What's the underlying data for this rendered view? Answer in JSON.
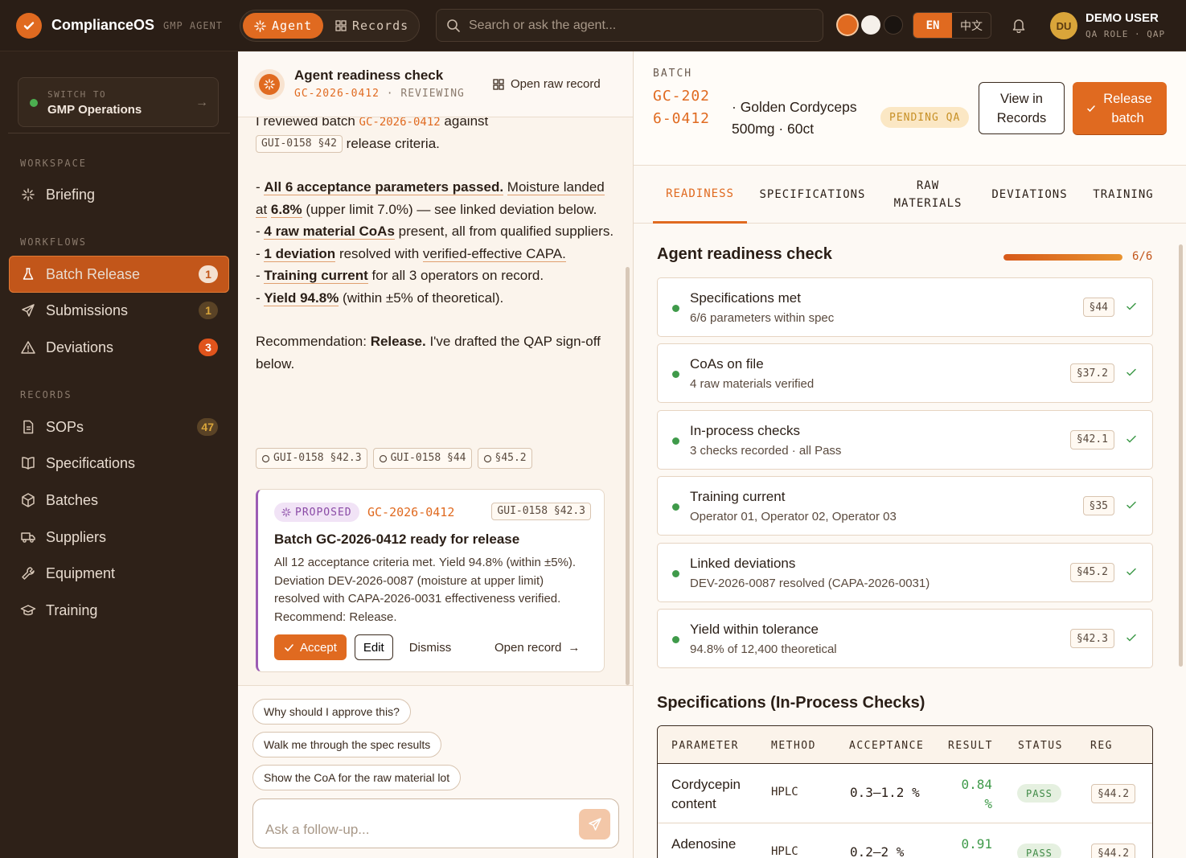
{
  "colors": {
    "accent": "#e06a20",
    "success": "#3f9a4a",
    "proposed": "#9c5cb4",
    "pending": "#c79026"
  },
  "topbar": {
    "brand": "ComplianceOS",
    "brand_sub": "GMP AGENT",
    "modes": [
      {
        "label": "Agent",
        "icon": "sparkle-icon",
        "active": true
      },
      {
        "label": "Records",
        "icon": "grid-icon",
        "active": false
      }
    ],
    "search_placeholder": "Search or ask the agent...",
    "themes": [
      "#e06a20",
      "#f5f0ea",
      "#1a1410"
    ],
    "lang": {
      "en": "EN",
      "zh": "中文",
      "active": "EN"
    },
    "user": {
      "initials": "DU",
      "name": "DEMO USER",
      "role": "QA ROLE · QAP"
    }
  },
  "sidebar": {
    "switch": {
      "kicker": "SWITCH TO",
      "value": "GMP Operations"
    },
    "sections": {
      "workspace": "WORKSPACE",
      "workflows": "WORKFLOWS",
      "records": "RECORDS"
    },
    "workspace": [
      {
        "label": "Briefing",
        "icon": "sparkle-icon"
      }
    ],
    "workflows": [
      {
        "label": "Batch Release",
        "icon": "flask-icon",
        "badge": "1",
        "active": true
      },
      {
        "label": "Submissions",
        "icon": "send-icon",
        "badge": "1"
      },
      {
        "label": "Deviations",
        "icon": "warning-icon",
        "badge": "3"
      }
    ],
    "records": [
      {
        "label": "SOPs",
        "icon": "document-icon",
        "badge": "47"
      },
      {
        "label": "Specifications",
        "icon": "book-icon"
      },
      {
        "label": "Batches",
        "icon": "box-icon"
      },
      {
        "label": "Suppliers",
        "icon": "truck-icon"
      },
      {
        "label": "Equipment",
        "icon": "wrench-icon"
      },
      {
        "label": "Training",
        "icon": "graduation-cap-icon"
      }
    ]
  },
  "chat": {
    "title": "Agent readiness check",
    "batch": "GC-2026-0412",
    "state": "REVIEWING",
    "open_raw": "Open raw record",
    "msg": {
      "l1a": "I reviewed batch",
      "l1b": "GC-2026-0412",
      "l1c": "against",
      "ref1": "GUI-0158 §42",
      "l1d": "release criteria.",
      "b1s": "All 6 acceptance parameters passed.",
      "b1a": "Moisture landed at",
      "b1v": "6.8%",
      "b1b": "(upper limit 7.0%) — see linked deviation below.",
      "b2s": "4 raw material CoAs",
      "b2a": "present, all from qualified suppliers.",
      "b3s": "1 deviation",
      "b3a": "resolved with",
      "b3u": "verified-effective CAPA.",
      "b4s": "Training current",
      "b4a": "for all 3 operators on record.",
      "b5s": "Yield 94.8%",
      "b5a": "(within ±5% of theoretical).",
      "r1": "Recommendation:",
      "r2": "Release.",
      "r3": "I've drafted the QAP sign-off below."
    },
    "refs": [
      "GUI-0158 §42.3",
      "GUI-0158 §44",
      "§45.2"
    ],
    "proposal": {
      "tag": "PROPOSED",
      "batch": "GC-2026-0412",
      "ref": "GUI-0158 §42.3",
      "title": "Batch GC-2026-0412 ready for release",
      "body": "All 12 acceptance criteria met. Yield 94.8% (within ±5%). Deviation DEV-2026-0087 (moisture at upper limit) resolved with CAPA-2026-0031 effectiveness verified. Recommend: Release.",
      "accept": "Accept",
      "edit": "Edit",
      "dismiss": "Dismiss",
      "open": "Open record"
    },
    "suggestions": [
      "Why should I approve this?",
      "Walk me through the spec results",
      "Show the CoA for the raw material lot"
    ],
    "followup_placeholder": "Ask a follow-up..."
  },
  "batch": {
    "kicker": "BATCH",
    "id": "GC-2026-0412",
    "product": "· Golden Cordyceps 500mg · 60ct",
    "status": "PENDING QA",
    "view": "View in Records",
    "release": "Release batch",
    "tabs": [
      "READINESS",
      "SPECIFICATIONS",
      "RAW MATERIALS",
      "DEVIATIONS",
      "TRAINING"
    ],
    "active_tab": "READINESS",
    "readiness": {
      "title": "Agent readiness check",
      "progress_text": "6/6",
      "progress": 1.0,
      "items": [
        {
          "title": "Specifications met",
          "sub": "6/6 parameters within spec",
          "ref": "§44"
        },
        {
          "title": "CoAs on file",
          "sub": "4 raw materials verified",
          "ref": "§37.2"
        },
        {
          "title": "In-process checks",
          "sub": "3 checks recorded · all Pass",
          "ref": "§42.1"
        },
        {
          "title": "Training current",
          "sub": "Operator 01, Operator 02, Operator 03",
          "ref": "§35"
        },
        {
          "title": "Linked deviations",
          "sub": "DEV-2026-0087 resolved (CAPA-2026-0031)",
          "ref": "§45.2"
        },
        {
          "title": "Yield within tolerance",
          "sub": "94.8% of 12,400 theoretical",
          "ref": "§42.3"
        }
      ]
    },
    "specs": {
      "title": "Specifications (In-Process Checks)",
      "headers": [
        "PARAMETER",
        "METHOD",
        "ACCEPTANCE",
        "RESULT",
        "STATUS",
        "REG"
      ],
      "rows": [
        {
          "param": "Cordycepin content",
          "method": "HPLC",
          "acceptance": "0.3–1.2 %",
          "result": "0.84 %",
          "status": "PASS",
          "reg": "§44.2"
        },
        {
          "param": "Adenosine",
          "method": "HPLC",
          "acceptance": "0.2–2 %",
          "result": "0.91",
          "status": "PASS",
          "reg": "§44.2"
        }
      ]
    }
  }
}
